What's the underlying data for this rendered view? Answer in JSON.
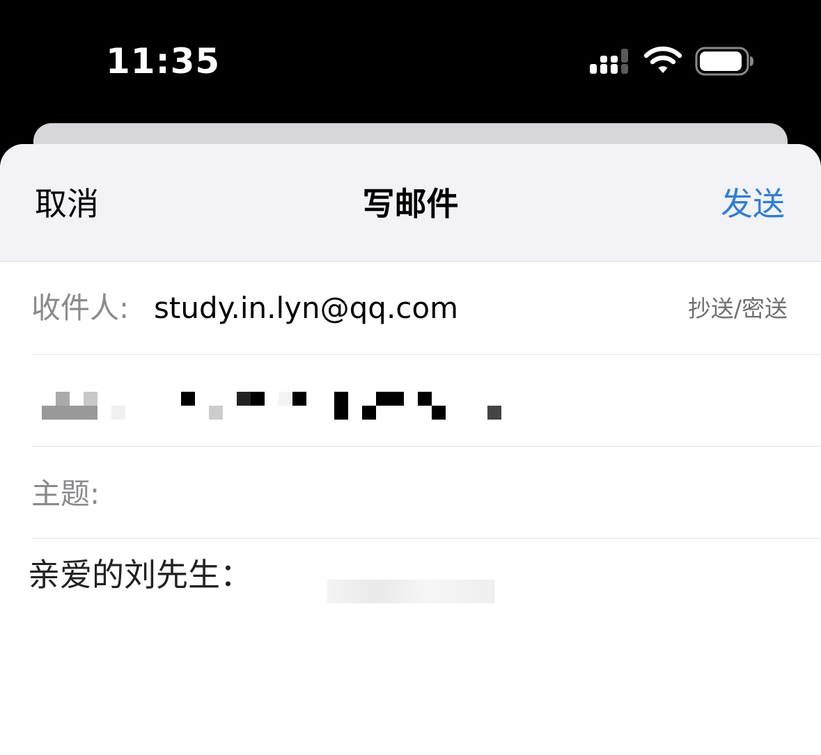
{
  "status_bar": {
    "time": "11:35",
    "icons": [
      "cellular-signal-icon",
      "wifi-icon",
      "battery-icon"
    ]
  },
  "nav": {
    "cancel_label": "取消",
    "title": "写邮件",
    "send_label": "发送"
  },
  "form": {
    "to_label": "收件人:",
    "to_value": "study.in.lyn@qq.com",
    "cc_bcc_label": "抄送/密送",
    "subject_label": "主题:",
    "subject_value": ""
  },
  "body": {
    "greeting": "亲爱的刘先生："
  },
  "colors": {
    "accent": "#2f7fd1",
    "nav_background": "#f2f2f7",
    "label_gray": "#8a8a8e",
    "status_bar_background": "#000000"
  }
}
